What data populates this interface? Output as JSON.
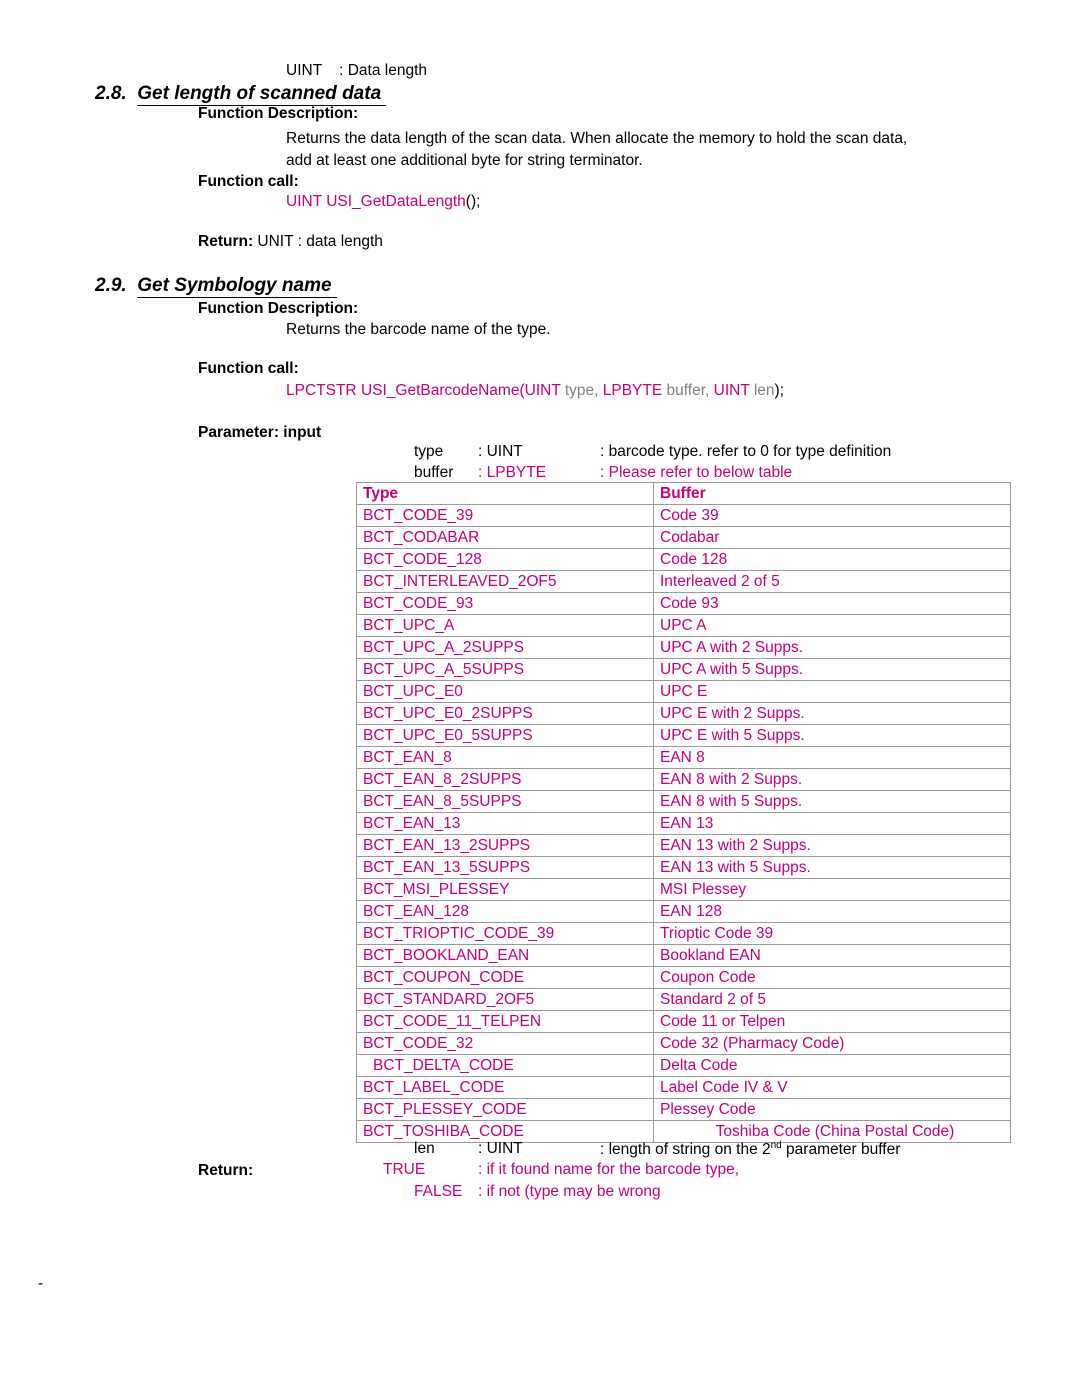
{
  "top_line": {
    "type": "UINT",
    "sep": ": Data length"
  },
  "section_28": {
    "number": "2.8.",
    "title": "Get length of scanned data ",
    "func_desc_label": "Function Description:",
    "func_desc_line1": "Returns the data length of the scan data. When allocate the memory to hold the scan data,",
    "func_desc_line2": "add at least one additional byte for string terminator.",
    "func_call_label": "Function call:",
    "func_call_type": "UINT",
    "func_call_name": "USI_GetDataLength",
    "func_call_tail": "();",
    "return_label": "Return:",
    "return_value": "UNIT : data length"
  },
  "section_29": {
    "number": "2.9.",
    "title": "Get Symbology name ",
    "func_desc_label": "Function Description:",
    "func_desc_line1": "Returns the barcode name of the type.",
    "func_call_label": "Function call:",
    "signature": {
      "ret_type": "LPCTSTR",
      "name": "USI_GetBarcodeName(",
      "p1_type": "UINT",
      "p1_name": " type,",
      "p2_type": "LPBYTE",
      "p2_name": " buffer,",
      "p3_type": "UINT",
      "p3_name": " len",
      "tail": ");"
    },
    "param_label": "Parameter: input",
    "param_type_name": "type",
    "param_type_colon": ": UINT",
    "param_type_desc": ": barcode type. refer to 0 for type definition",
    "param_buffer_name": "buffer",
    "param_buffer_colon": ": LPBYTE",
    "param_buffer_desc": ": Please refer to below table",
    "param_len_name": "len",
    "param_len_colon": ": UINT",
    "param_len_desc_pre": ": length of string on the 2",
    "param_len_desc_sup": "nd",
    "param_len_desc_post": " parameter buffer",
    "return_label": "Return:",
    "return_true": "TRUE",
    "return_true_desc": ": if it found name for the barcode type,",
    "return_false": "FALSE",
    "return_false_desc": ": if not (type may be wrong"
  },
  "table": {
    "headers": [
      "Type",
      "Buffer"
    ],
    "rows": [
      [
        "BCT_CODE_39",
        "Code 39"
      ],
      [
        "BCT_CODABAR",
        "Codabar"
      ],
      [
        "BCT_CODE_128",
        "Code 128"
      ],
      [
        "BCT_INTERLEAVED_2OF5",
        "Interleaved 2 of 5"
      ],
      [
        "BCT_CODE_93",
        "Code 93"
      ],
      [
        "BCT_UPC_A",
        "UPC A"
      ],
      [
        "BCT_UPC_A_2SUPPS",
        "UPC A with 2 Supps."
      ],
      [
        "BCT_UPC_A_5SUPPS",
        "UPC A with 5 Supps."
      ],
      [
        "BCT_UPC_E0",
        "UPC E"
      ],
      [
        "BCT_UPC_E0_2SUPPS",
        "UPC E with 2 Supps."
      ],
      [
        "BCT_UPC_E0_5SUPPS",
        "UPC E with 5 Supps."
      ],
      [
        "BCT_EAN_8",
        "EAN 8"
      ],
      [
        "BCT_EAN_8_2SUPPS",
        "EAN 8 with 2 Supps."
      ],
      [
        "BCT_EAN_8_5SUPPS",
        "EAN 8 with 5 Supps."
      ],
      [
        "BCT_EAN_13",
        "EAN 13"
      ],
      [
        "BCT_EAN_13_2SUPPS",
        "EAN 13 with 2 Supps."
      ],
      [
        "BCT_EAN_13_5SUPPS",
        "EAN 13 with 5 Supps."
      ],
      [
        "BCT_MSI_PLESSEY",
        "MSI Plessey"
      ],
      [
        "BCT_EAN_128",
        "EAN 128"
      ],
      [
        "BCT_TRIOPTIC_CODE_39",
        "Trioptic Code 39"
      ],
      [
        "BCT_BOOKLAND_EAN",
        "Bookland EAN"
      ],
      [
        "BCT_COUPON_CODE",
        "Coupon Code"
      ],
      [
        "BCT_STANDARD_2OF5",
        "Standard 2 of 5"
      ],
      [
        "BCT_CODE_11_TELPEN",
        "Code 11 or Telpen"
      ],
      [
        "BCT_CODE_32",
        "Code 32 (Pharmacy Code)"
      ],
      [
        "BCT_DELTA_CODE",
        "Delta Code"
      ],
      [
        "BCT_LABEL_CODE",
        "Label Code IV & V"
      ],
      [
        "BCT_PLESSEY_CODE",
        "Plessey Code"
      ],
      [
        "BCT_TOSHIBA_CODE",
        "Toshiba Code (China Postal Code)"
      ]
    ]
  },
  "footer": {
    "dash": "-"
  }
}
